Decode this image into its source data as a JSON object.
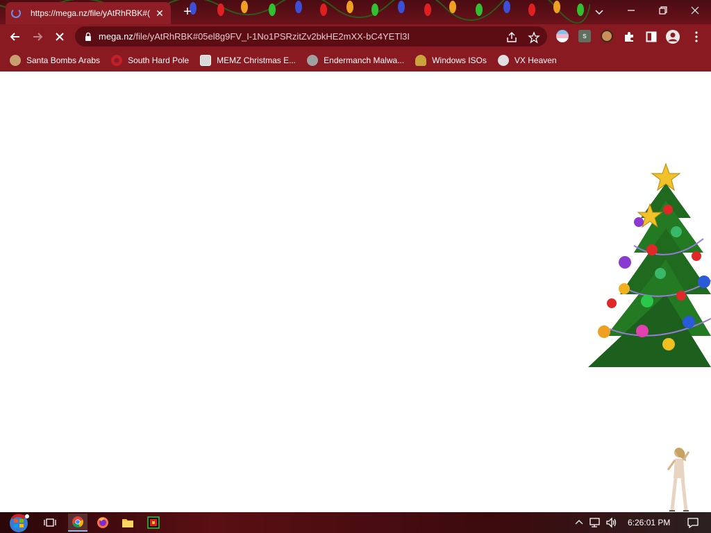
{
  "browser": {
    "tab": {
      "title": "https://mega.nz/file/yAtRhRBK#("
    },
    "address_bar": {
      "host": "mega.nz",
      "path": "/file/yAtRhRBK#05el8g9FV_I-1No1PSRzitZv2bkHE2mXX-bC4YETl3I"
    },
    "bookmarks": [
      {
        "label": "Santa Bombs Arabs",
        "icon": "santa-icon",
        "color": "#c8a070"
      },
      {
        "label": "South Hard Pole",
        "icon": "red-gear-icon",
        "color": "#c0202a"
      },
      {
        "label": "MEMZ Christmas E...",
        "icon": "image-file-icon",
        "color": "#d8d8d8"
      },
      {
        "label": "Endermanch Malwa...",
        "icon": "raccoon-icon",
        "color": "#a0a0a0"
      },
      {
        "label": "Windows ISOs",
        "icon": "buddha-icon",
        "color": "#c9a43a"
      },
      {
        "label": "VX Heaven",
        "icon": "vx-heaven-icon",
        "color": "#e0e0e0"
      }
    ]
  },
  "taskbar": {
    "clock": "6:26:01 PM"
  },
  "colors": {
    "titlebar": "#4a0c12",
    "toolbar": "#8a1a22",
    "omnibox": "#5c0d13",
    "page": "#ffffff"
  }
}
